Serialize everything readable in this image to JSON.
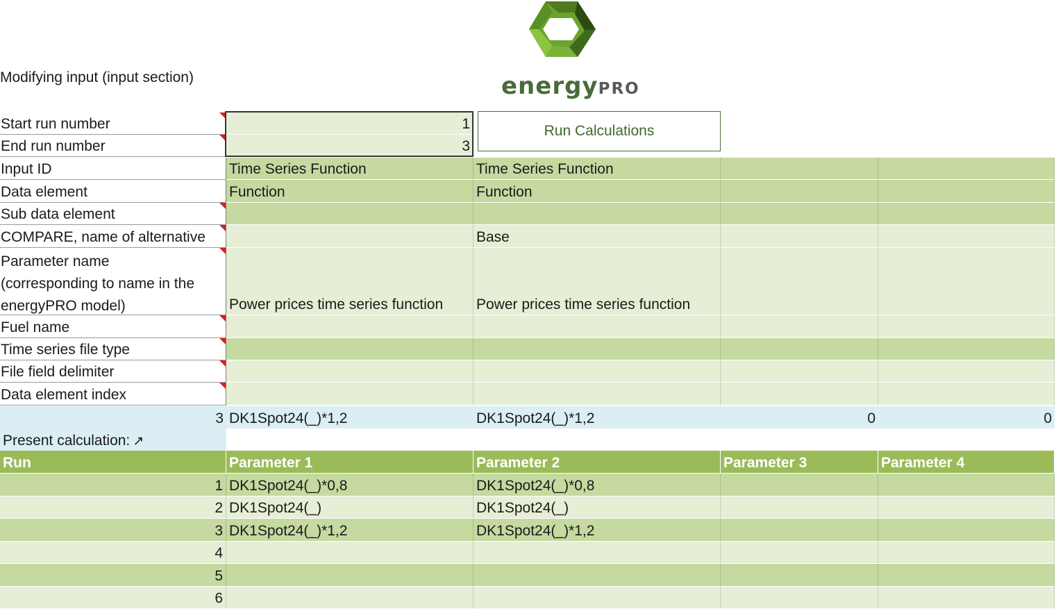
{
  "logo": {
    "brand_main": "energy",
    "brand_suffix": "PRO",
    "colors": [
      "#4f7a1f",
      "#8bc43f",
      "#2d4a14",
      "#6aa32d"
    ]
  },
  "section_title": "Modifying input (input section)",
  "run_button": "Run Calculations",
  "start_run": {
    "label": "Start run number",
    "value": "1"
  },
  "end_run": {
    "label": "End run number",
    "value": "3"
  },
  "rows": [
    {
      "label": "Input ID",
      "values": [
        "Time Series Function",
        "Time Series Function",
        "",
        ""
      ]
    },
    {
      "label": "Data element",
      "values": [
        "Function",
        "Function",
        "",
        ""
      ]
    },
    {
      "label": "Sub data element",
      "values": [
        "",
        "",
        "",
        ""
      ]
    },
    {
      "label": "COMPARE, name of alternative",
      "values": [
        "",
        "Base",
        "",
        ""
      ]
    },
    {
      "label_lines": [
        "Parameter name",
        "(corresponding to name in the",
        "energyPRO model)"
      ],
      "values": [
        "Power prices time series function",
        "Power prices time series function",
        "",
        ""
      ]
    },
    {
      "label": "Fuel name",
      "values": [
        "",
        "",
        "",
        ""
      ]
    },
    {
      "label": "Time series file type",
      "values": [
        "",
        "",
        "",
        ""
      ]
    },
    {
      "label": "File field delimiter",
      "values": [
        "",
        "",
        "",
        ""
      ]
    },
    {
      "label": "Data element index",
      "values": [
        "",
        "",
        "",
        ""
      ]
    }
  ],
  "present_row": {
    "run": "3",
    "values": [
      "DK1Spot24(_)*1,2",
      "DK1Spot24(_)*1,2",
      "0",
      "0"
    ]
  },
  "present_label": "Present calculation:",
  "table_headers": [
    "Run",
    "Parameter 1",
    "Parameter 2",
    "Parameter 3",
    "Parameter 4"
  ],
  "runs": [
    {
      "run": "1",
      "values": [
        "DK1Spot24(_)*0,8",
        "DK1Spot24(_)*0,8",
        "",
        ""
      ]
    },
    {
      "run": "2",
      "values": [
        "DK1Spot24(_)",
        "DK1Spot24(_)",
        "",
        ""
      ]
    },
    {
      "run": "3",
      "values": [
        "DK1Spot24(_)*1,2",
        "DK1Spot24(_)*1,2",
        "",
        ""
      ]
    },
    {
      "run": "4",
      "values": [
        "",
        "",
        "",
        ""
      ]
    },
    {
      "run": "5",
      "values": [
        "",
        "",
        "",
        ""
      ]
    },
    {
      "run": "6",
      "values": [
        "",
        "",
        "",
        ""
      ]
    }
  ]
}
